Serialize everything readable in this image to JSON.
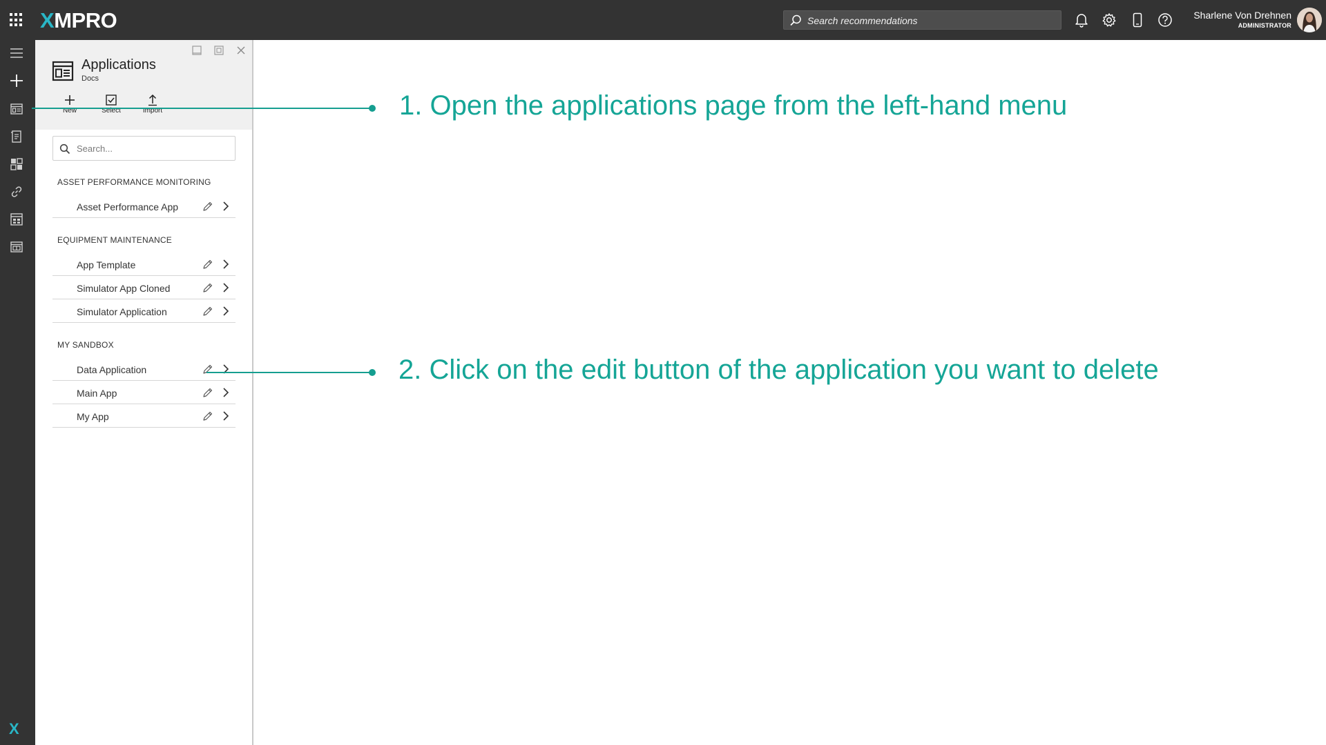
{
  "header": {
    "logo_prefix": "X",
    "logo_rest": "MPRO",
    "search_placeholder": "Search recommendations",
    "user_name": "Sharlene Von Drehnen",
    "user_role": "ADMINISTRATOR",
    "icons": [
      "apps-grid-icon",
      "search-icon",
      "bell-icon",
      "gear-icon",
      "phone-icon",
      "help-icon"
    ],
    "accent_color": "#29b6c6"
  },
  "rail": {
    "icons": [
      "hamburger-icon",
      "plus-icon",
      "applications-icon",
      "recommendations-icon",
      "dashboard-icon",
      "link-icon",
      "calculator-icon",
      "window-icon"
    ],
    "logo": "X"
  },
  "panel": {
    "title": "Applications",
    "subtitle": "Docs",
    "toolbar": {
      "new_label": "New",
      "select_label": "Select",
      "import_label": "Import"
    },
    "search_placeholder": "Search...",
    "groups": [
      {
        "title": "ASSET PERFORMANCE MONITORING",
        "items": [
          "Asset Performance App"
        ]
      },
      {
        "title": "EQUIPMENT MAINTENANCE",
        "items": [
          "App Template",
          "Simulator App Cloned",
          "Simulator Application"
        ]
      },
      {
        "title": "MY SANDBOX",
        "items": [
          "Data Application",
          "Main App",
          "My App"
        ]
      }
    ]
  },
  "annotations": {
    "step1": "1. Open the applications page from the left-hand menu",
    "step2": "2. Click on the edit button of the application you want to delete",
    "color": "#159e90"
  }
}
